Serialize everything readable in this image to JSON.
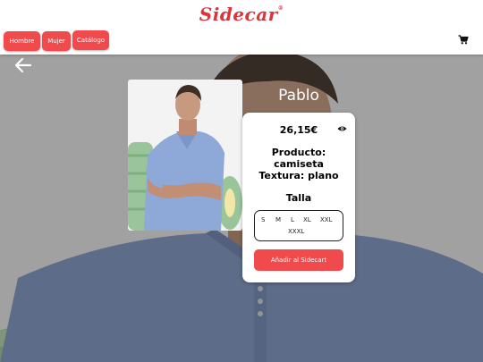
{
  "header": {
    "logo_text": "Sidecar",
    "logo_mark": "®",
    "nav": [
      {
        "label": "Hombre"
      },
      {
        "label": "Mujer"
      },
      {
        "label": "Catálogo"
      }
    ],
    "cart_icon": "shopping-cart-icon"
  },
  "colors": {
    "accent": "#f04a4c",
    "logo": "#d9353b",
    "card_bg": "#ffffff"
  },
  "page": {
    "back_icon": "arrow-left-icon",
    "model_name": "Pablo"
  },
  "product": {
    "price": "26,15€",
    "view_icon": "eye-icon",
    "product_line1": "Producto:",
    "product_line2": "camiseta",
    "texture_line": "Textura: plano",
    "size_label": "Talla",
    "sizes": [
      "S",
      "M",
      "L",
      "XL",
      "XXL",
      "XXXL"
    ],
    "add_button": "Añadir al Sidecart"
  }
}
